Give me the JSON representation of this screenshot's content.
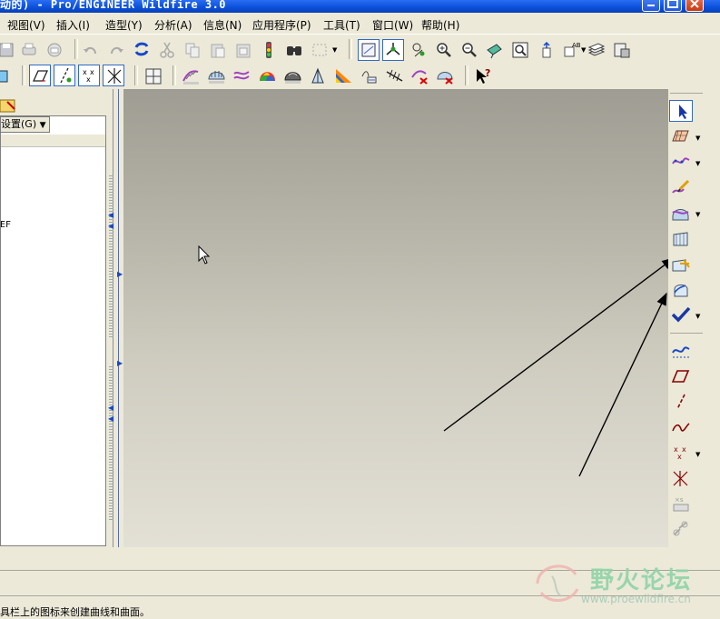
{
  "window": {
    "title": "动的) - Pro/ENGINEER Wildfire 3.0"
  },
  "menubar": {
    "items": [
      "视图(V)",
      "插入(I)",
      "造型(Y)",
      "分析(A)",
      "信息(N)",
      "应用程序(P)",
      "工具(T)",
      "窗口(W)",
      "帮助(H)"
    ]
  },
  "toolbar1": {
    "icons": [
      "save-icon",
      "print-icon",
      "email-icon",
      "undo-icon",
      "redo-icon",
      "regenerate-icon",
      "cut-icon",
      "copy-icon",
      "paste-icon",
      "paste-special-icon",
      "traffic-light-icon",
      "find-icon",
      "select-box-icon",
      "datum-plane-display-icon",
      "datum-axis-display-icon",
      "spin-center-icon",
      "zoom-in-icon",
      "zoom-out-icon",
      "orient-icon",
      "refit-icon",
      "view-manager-icon",
      "named-views-icon",
      "layers-icon",
      "appearance-icon"
    ]
  },
  "toolbar2": {
    "icons": [
      "datum-plane-toggle-icon",
      "datum-axis-toggle-icon",
      "datum-point-toggle-icon",
      "coordinate-system-toggle-icon",
      "grid-icon",
      "curvature-icon",
      "section-analysis-icon",
      "offset-icon",
      "reflection-icon",
      "shading-icon",
      "draft-icon",
      "slope-icon",
      "dihedral-icon",
      "curve-analysis-icon",
      "delete-analysis-icon",
      "delete-all-icon",
      "whats-this-icon"
    ]
  },
  "left_pane": {
    "settings_label": "设置(G)",
    "tree_fragment": "EF"
  },
  "right_toolbar": {
    "icons": [
      "select-arrow-icon",
      "active-plane-icon",
      "curve-icon",
      "edit-curve-icon",
      "boundary-surface-icon",
      "connect-surface-icon",
      "trim-surface-icon",
      "curve-from-surface-icon",
      "done-check-icon",
      "style-curve-icon",
      "datum-plane-icon",
      "datum-axis-icon",
      "sketched-curve-icon",
      "datum-point-icon",
      "coordinate-system-icon",
      "analysis-icon",
      "link-icon"
    ]
  },
  "status": {
    "message": "具栏上的图标来创建曲线和曲面。"
  },
  "watermark": {
    "name": "野火论坛",
    "url": "www.proewildfire.cn"
  }
}
